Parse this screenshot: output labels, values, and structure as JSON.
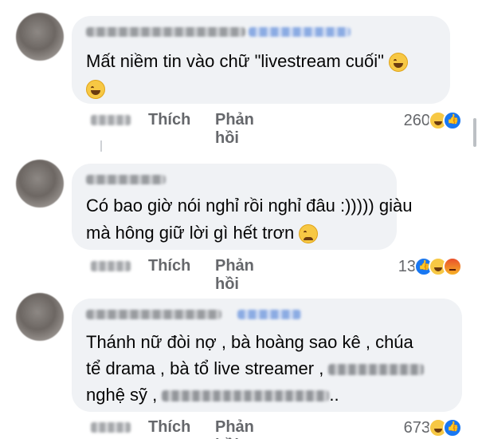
{
  "comments": [
    {
      "text_line1": "Mất niềm tin vào chữ \"livestream cuối\"",
      "like_label": "Thích",
      "reply_label": "Phản hồi",
      "reaction_count": "260",
      "reactions": [
        "haha",
        "like"
      ]
    },
    {
      "text_line1": "Có bao giờ nói nghỉ rồi nghỉ đâu :))))) giàu",
      "text_line2": "mà hông giữ lời gì hết trơn",
      "like_label": "Thích",
      "reply_label": "Phản hồi",
      "reaction_count": "13",
      "reactions": [
        "like",
        "haha",
        "angry"
      ]
    },
    {
      "text_line1": "Thánh nữ đòi nợ , bà hoàng sao kê , chúa",
      "text_line2": "tể drama , bà tổ live streamer ,",
      "text_line3_a": "nghệ sỹ ,",
      "text_line3_b": "..",
      "like_label": "Thích",
      "reply_label": "Phản hồi",
      "reaction_count": "673",
      "reactions": [
        "haha",
        "like"
      ]
    }
  ],
  "icons": {
    "haha": "haha-reaction-icon",
    "like": "like-reaction-icon",
    "angry": "angry-reaction-icon"
  },
  "colors": {
    "bubble": "#f0f2f5",
    "secondary_text": "#65676b",
    "like_blue": "#1877f2"
  }
}
